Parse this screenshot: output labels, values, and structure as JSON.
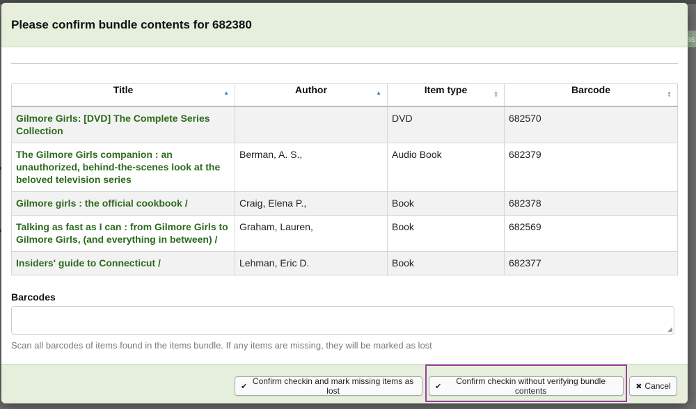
{
  "modal": {
    "title": "Please confirm bundle contents for 682380"
  },
  "table": {
    "columns": [
      {
        "label": "Title",
        "sort": "asc"
      },
      {
        "label": "Author",
        "sort": "asc"
      },
      {
        "label": "Item type",
        "sort": "both"
      },
      {
        "label": "Barcode",
        "sort": "both"
      }
    ],
    "rows": [
      {
        "title": "Gilmore Girls: [DVD] The Complete Series Collection",
        "author": "",
        "item_type": "DVD",
        "barcode": "682570"
      },
      {
        "title": "The Gilmore Girls companion : an unauthorized, behind-the-scenes look at the beloved television series",
        "author": "Berman, A. S.,",
        "item_type": "Audio Book",
        "barcode": "682379"
      },
      {
        "title": "Gilmore girls : the official cookbook /",
        "author": "Craig, Elena P.,",
        "item_type": "Book",
        "barcode": "682378"
      },
      {
        "title": "Talking as fast as I can : from Gilmore Girls to Gilmore Girls, (and everything in between) /",
        "author": "Graham, Lauren,",
        "item_type": "Book",
        "barcode": "682569"
      },
      {
        "title": "Insiders' guide to Connecticut /",
        "author": "Lehman, Eric D.",
        "item_type": "Book",
        "barcode": "682377"
      }
    ]
  },
  "barcodes": {
    "label": "Barcodes",
    "value": "",
    "help": "Scan all barcodes of items found in the items bundle. If any items are missing, they will be marked as lost"
  },
  "footer": {
    "confirm_mark_missing": "Confirm checkin and mark missing items as lost",
    "confirm_no_verify": "Confirm checkin without verifying bundle contents",
    "cancel": "Cancel"
  },
  "backdrop": {
    "chip_text": "as"
  },
  "colors": {
    "header_bg": "#e6efdc",
    "link": "#2d6a1c",
    "highlight": "#9a3fa0"
  }
}
